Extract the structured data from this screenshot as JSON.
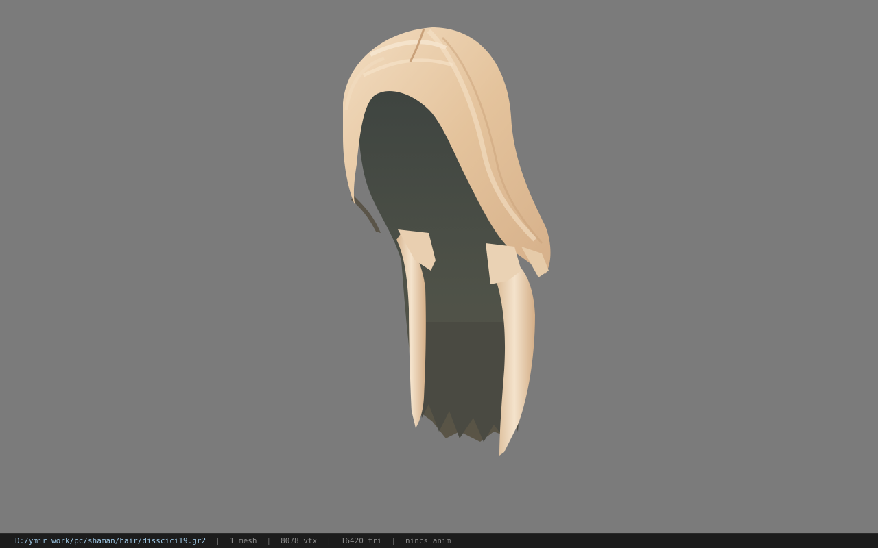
{
  "viewer": {
    "background_color": "#7b7b7b",
    "model_subject": "hair-mesh"
  },
  "status": {
    "path": "D:/ymir work/pc/shaman/hair/disscici19.gr2",
    "separator": "|",
    "mesh": "1 mesh",
    "vertices": "8078 vtx",
    "triangles": "16420 tri",
    "anim": "nincs anim"
  }
}
